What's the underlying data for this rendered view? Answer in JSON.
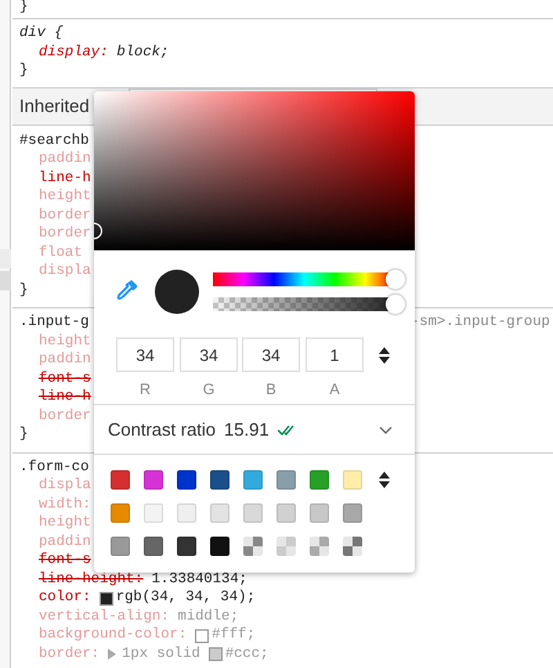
{
  "rules": [
    {
      "selector": "}"
    },
    {
      "selector": "div {",
      "italic": true,
      "declarations": [
        {
          "name": "display:",
          "value": "block;",
          "dimmed": false,
          "overridden": false
        }
      ],
      "close": "}"
    },
    {
      "kind": "inherited",
      "label": "Inherited"
    },
    {
      "selector": "#searchb",
      "declarations": [
        {
          "name": "paddin",
          "dimmed": true,
          "overridden": false
        },
        {
          "name": "line-h",
          "dimmed": false,
          "overridden": false
        },
        {
          "name": "height",
          "dimmed": true,
          "overridden": false
        },
        {
          "name": "border",
          "dimmed": true,
          "overridden": false
        },
        {
          "name": "border",
          "dimmed": true,
          "overridden": false
        },
        {
          "name": "float",
          "dimmed": true,
          "overridden": false
        },
        {
          "name": "displa",
          "dimmed": true,
          "overridden": false
        }
      ],
      "close": "}"
    },
    {
      "selector": ".input-g",
      "selector_tail": "-sm>.input-group",
      "declarations": [
        {
          "name": "height",
          "dimmed": true,
          "overridden": false
        },
        {
          "name": "paddin",
          "dimmed": true,
          "overridden": false
        },
        {
          "name": "font-s",
          "dimmed": false,
          "overridden": true
        },
        {
          "name": "line-h",
          "dimmed": false,
          "overridden": true
        },
        {
          "name": "border",
          "dimmed": true,
          "overridden": false
        }
      ],
      "close": "}"
    },
    {
      "selector": ".form-co",
      "declarations": [
        {
          "name": "displa",
          "dimmed": true,
          "overridden": false
        },
        {
          "name": "width:",
          "dimmed": true,
          "overridden": false
        },
        {
          "name": "height",
          "dimmed": true,
          "overridden": false
        },
        {
          "name": "paddin",
          "dimmed": true,
          "overridden": false
        },
        {
          "name": "font-s",
          "dimmed": false,
          "overridden": true
        },
        {
          "name": "line-height:",
          "value": "1.33840134;",
          "dimmed": false,
          "overridden": true
        },
        {
          "name": "color:",
          "color": "#222222",
          "value": "rgb(34, 34, 34);",
          "dimmed": false,
          "overridden": false
        },
        {
          "name": "vertical-align:",
          "value": "middle;",
          "dimmed": true,
          "overridden": false
        },
        {
          "name": "background-color:",
          "color": "#ffffff",
          "value": "#fff;",
          "dimmed": true,
          "overridden": false
        },
        {
          "name": "border:",
          "expandable": true,
          "prefix": "1px solid",
          "color": "#cccccc",
          "value": "#ccc;",
          "dimmed": true,
          "overridden": false
        }
      ]
    }
  ],
  "picker": {
    "hue": {
      "level": 1
    },
    "alpha": {
      "level": 1
    },
    "current": {
      "color": "#222222"
    },
    "channels": [
      {
        "value": "34",
        "label": "R"
      },
      {
        "value": "34",
        "label": "G"
      },
      {
        "value": "34",
        "label": "B"
      },
      {
        "value": "1",
        "label": "A"
      }
    ],
    "contrast": {
      "label": "Contrast ratio",
      "value": "15.91"
    },
    "swatches": [
      {
        "color": "#d32f2f",
        "kind": "solid"
      },
      {
        "color": "#d633d6",
        "kind": "solid"
      },
      {
        "color": "#0033cc",
        "kind": "solid"
      },
      {
        "color": "#1a4f8a",
        "kind": "solid"
      },
      {
        "color": "#33aadd",
        "kind": "solid"
      },
      {
        "color": "#889ea8",
        "kind": "solid"
      },
      {
        "color": "#28a028",
        "kind": "solid"
      },
      {
        "color": "#ffeeaa",
        "kind": "solid"
      },
      {
        "color": "#e68a00",
        "kind": "solid"
      },
      {
        "color": "#f3f3f3",
        "kind": "solid"
      },
      {
        "color": "#efefef",
        "kind": "solid"
      },
      {
        "color": "#e3e3e3",
        "kind": "solid"
      },
      {
        "color": "#d9d9d9",
        "kind": "solid"
      },
      {
        "color": "#d1d1d1",
        "kind": "solid"
      },
      {
        "color": "#c8c8c8",
        "kind": "solid"
      },
      {
        "color": "#a8a8a8",
        "kind": "solid"
      },
      {
        "color": "#999999",
        "kind": "solid"
      },
      {
        "color": "#666666",
        "kind": "solid"
      },
      {
        "color": "#333333",
        "kind": "solid"
      },
      {
        "color": "#111111",
        "kind": "solid"
      },
      {
        "color": "#888888",
        "kind": "translucent"
      },
      {
        "color": "#cccccc",
        "kind": "translucent"
      },
      {
        "color": "#aaaaaa",
        "kind": "translucent"
      },
      {
        "color": "#777777",
        "kind": "translucent"
      }
    ]
  }
}
